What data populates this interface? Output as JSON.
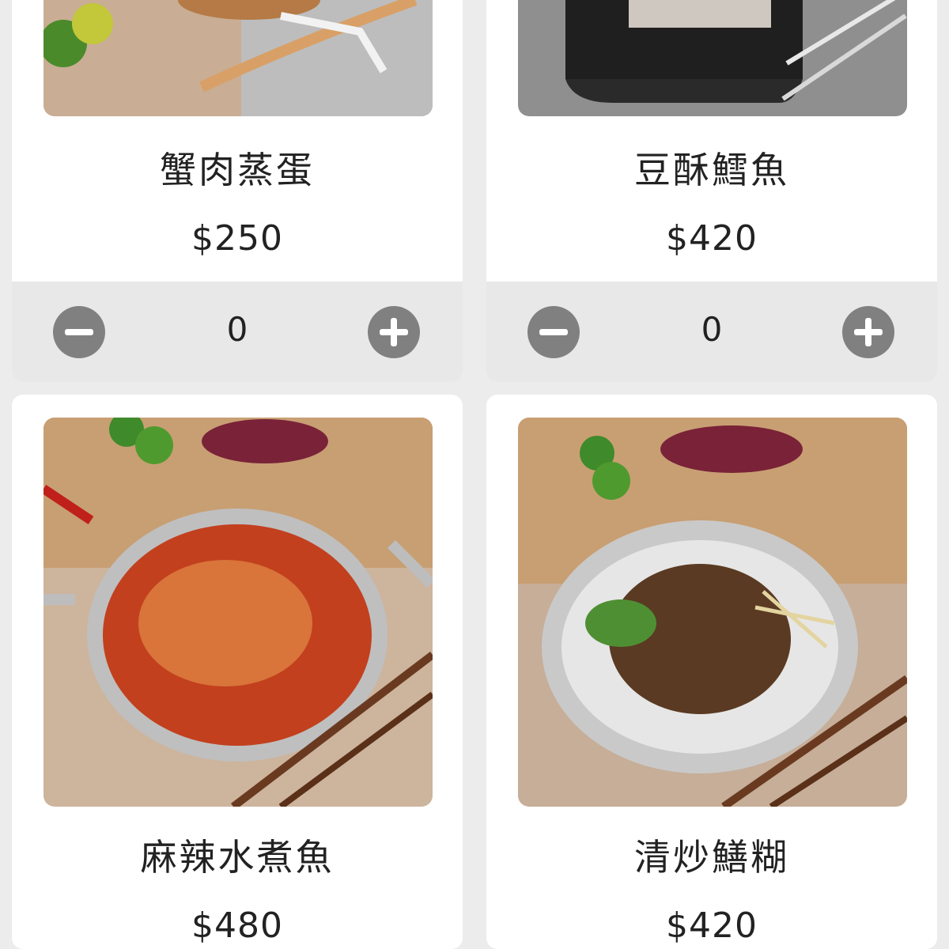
{
  "items": [
    {
      "name": "蟹肉蒸蛋",
      "price": "$250",
      "qty": "0"
    },
    {
      "name": "豆酥鱈魚",
      "price": "$420",
      "qty": "0"
    },
    {
      "name": "麻辣水煮魚",
      "price": "$480"
    },
    {
      "name": "清炒鱔糊",
      "price": "$420"
    }
  ],
  "icons": {
    "minus": "minus-circle-icon",
    "plus": "plus-circle-icon"
  },
  "colors": {
    "page_bg": "#ececec",
    "card_bg": "#ffffff",
    "qty_bar_bg": "#e8e8e8",
    "qty_button": "#808080"
  }
}
